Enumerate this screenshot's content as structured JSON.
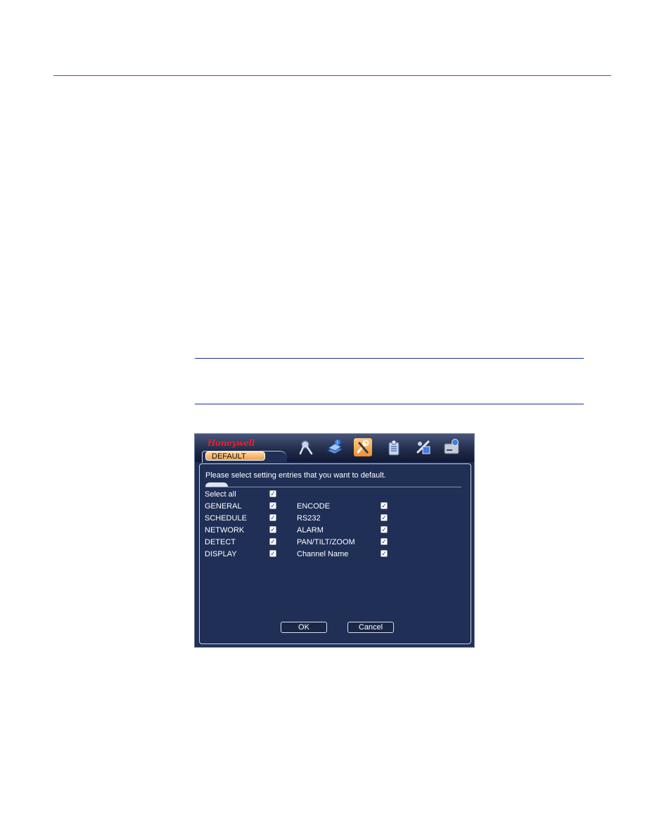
{
  "dialog": {
    "brand": "Honeywell",
    "tab_label": "DEFAULT",
    "prompt": "Please select setting entries that you want to default.",
    "select_all": {
      "label": "Select all",
      "checked": true
    },
    "left_items": [
      {
        "label": "GENERAL",
        "checked": true
      },
      {
        "label": "SCHEDULE",
        "checked": true
      },
      {
        "label": "NETWORK",
        "checked": true
      },
      {
        "label": "DETECT",
        "checked": true
      },
      {
        "label": "DISPLAY",
        "checked": true
      }
    ],
    "right_items": [
      {
        "label": "ENCODE",
        "checked": true
      },
      {
        "label": "RS232",
        "checked": true
      },
      {
        "label": "ALARM",
        "checked": true
      },
      {
        "label": "PAN/TILT/ZOOM",
        "checked": true
      },
      {
        "label": "Channel Name",
        "checked": true
      }
    ],
    "ok_label": "OK",
    "cancel_label": "Cancel",
    "nav_icons": [
      "search-icon",
      "info-book-icon",
      "tools-icon",
      "users-icon",
      "advanced-icon",
      "disk-icon"
    ],
    "check_mark": "✓"
  },
  "colors": {
    "header_rule": "#d0281e",
    "note_rule": "#1b2fa0",
    "window_bg": "#1f2f56",
    "active_tab": "#f0a04a"
  }
}
